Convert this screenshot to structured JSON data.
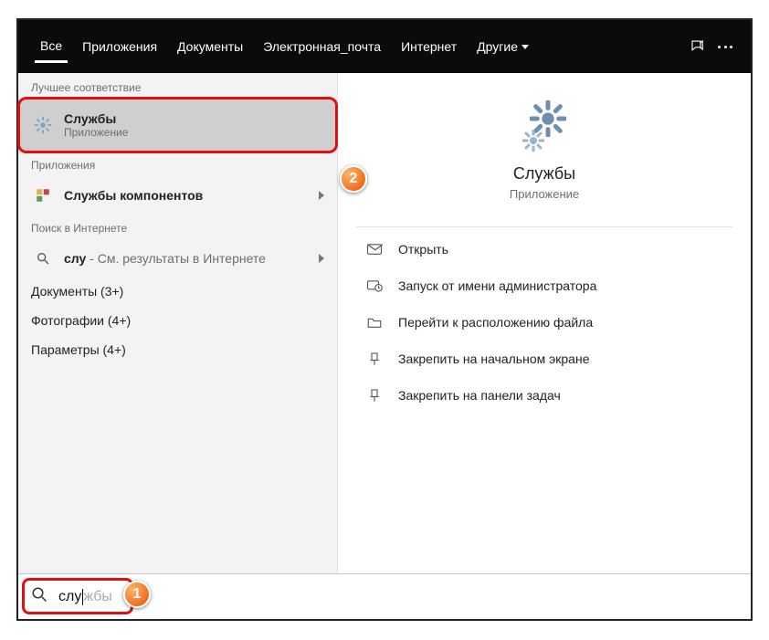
{
  "topbar": {
    "tabs": [
      {
        "label": "Все",
        "active": true
      },
      {
        "label": "Приложения",
        "active": false
      },
      {
        "label": "Документы",
        "active": false
      },
      {
        "label": "Электронная_почта",
        "active": false
      },
      {
        "label": "Интернет",
        "active": false
      },
      {
        "label": "Другие",
        "active": false,
        "more": true
      }
    ]
  },
  "left": {
    "best_header": "Лучшее соответствие",
    "best": {
      "title": "Службы",
      "subtitle": "Приложение"
    },
    "apps_header": "Приложения",
    "apps": [
      {
        "title": "Службы компонентов",
        "chevron": true
      }
    ],
    "web_header": "Поиск в Интернете",
    "web": {
      "query": "слу",
      "hint": " - См. результаты в Интернете",
      "chevron": true
    },
    "extras": [
      {
        "label": "Документы (3+)"
      },
      {
        "label": "Фотографии (4+)"
      },
      {
        "label": "Параметры (4+)"
      }
    ]
  },
  "preview": {
    "title": "Службы",
    "subtitle": "Приложение",
    "actions": [
      {
        "label": "Открыть",
        "icon": "open"
      },
      {
        "label": "Запуск от имени администратора",
        "icon": "admin"
      },
      {
        "label": "Перейти к расположению файла",
        "icon": "location"
      },
      {
        "label": "Закрепить на начальном экране",
        "icon": "pin-start"
      },
      {
        "label": "Закрепить на панели задач",
        "icon": "pin-taskbar"
      }
    ]
  },
  "search": {
    "typed": "слу",
    "ghost": "жбы"
  },
  "callouts": {
    "one": "1",
    "two": "2"
  }
}
